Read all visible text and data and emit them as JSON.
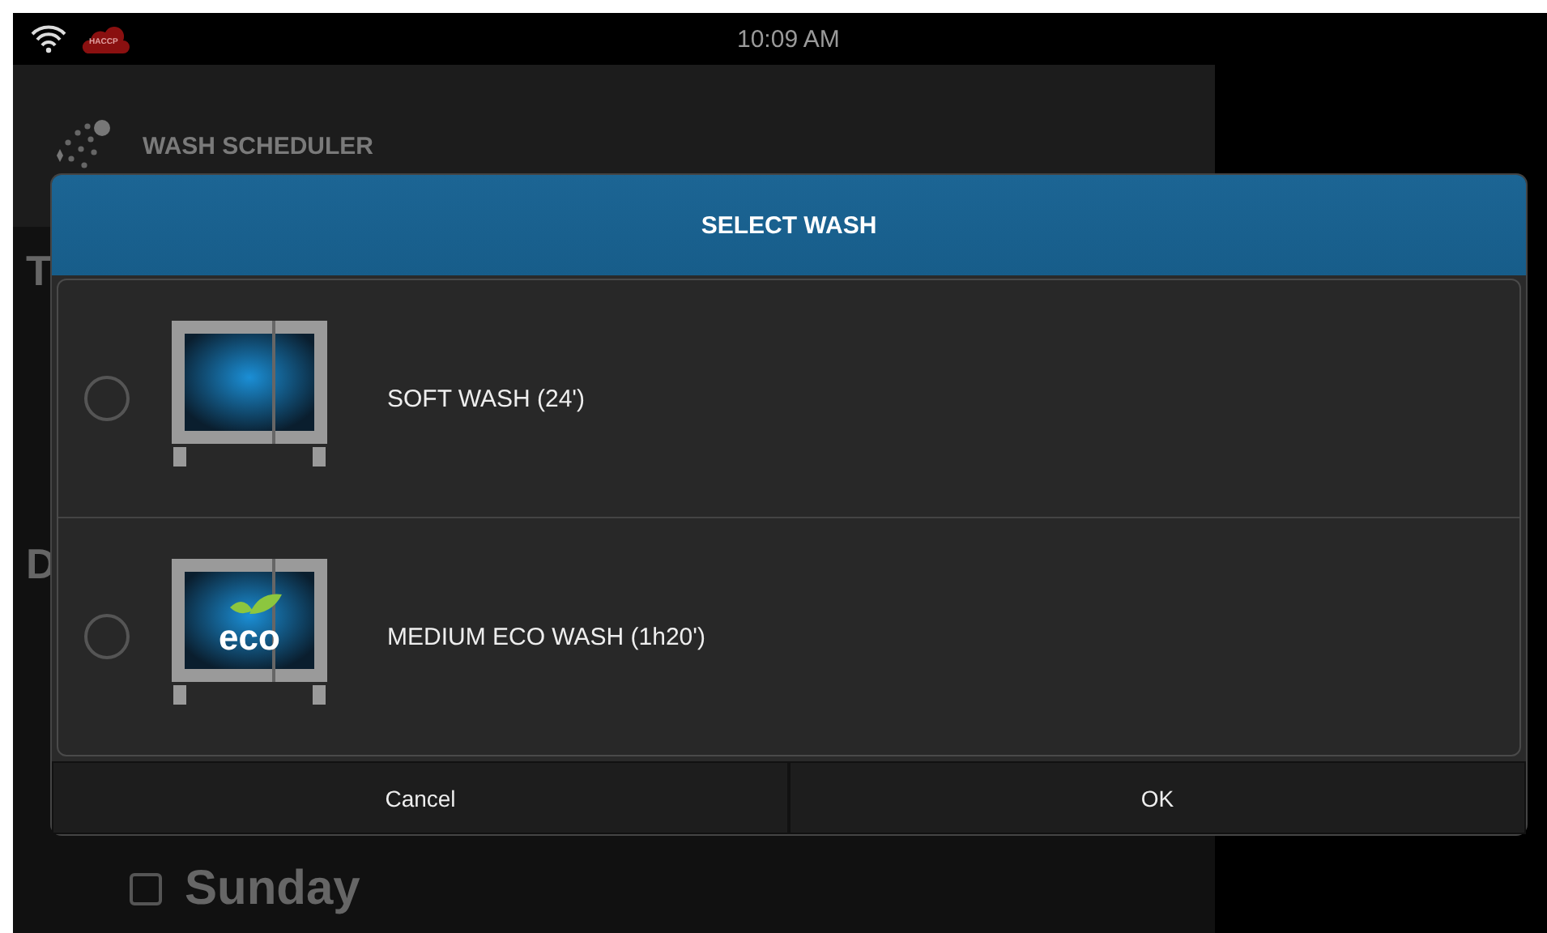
{
  "status_bar": {
    "cloud_badge": "HACCP",
    "time": "10:09 AM"
  },
  "app": {
    "title": "WASH SCHEDULER",
    "labels": [
      "T",
      "D"
    ],
    "days": [
      {
        "label": "Sunday",
        "checked": false
      }
    ]
  },
  "dialog": {
    "title": "SELECT WASH",
    "options": [
      {
        "label": "SOFT WASH (24')",
        "selected": false,
        "kind": "plain"
      },
      {
        "label": "MEDIUM ECO WASH (1h20')",
        "selected": false,
        "kind": "eco",
        "icon_text": "eco"
      }
    ],
    "buttons": [
      "Cancel",
      "OK"
    ]
  }
}
